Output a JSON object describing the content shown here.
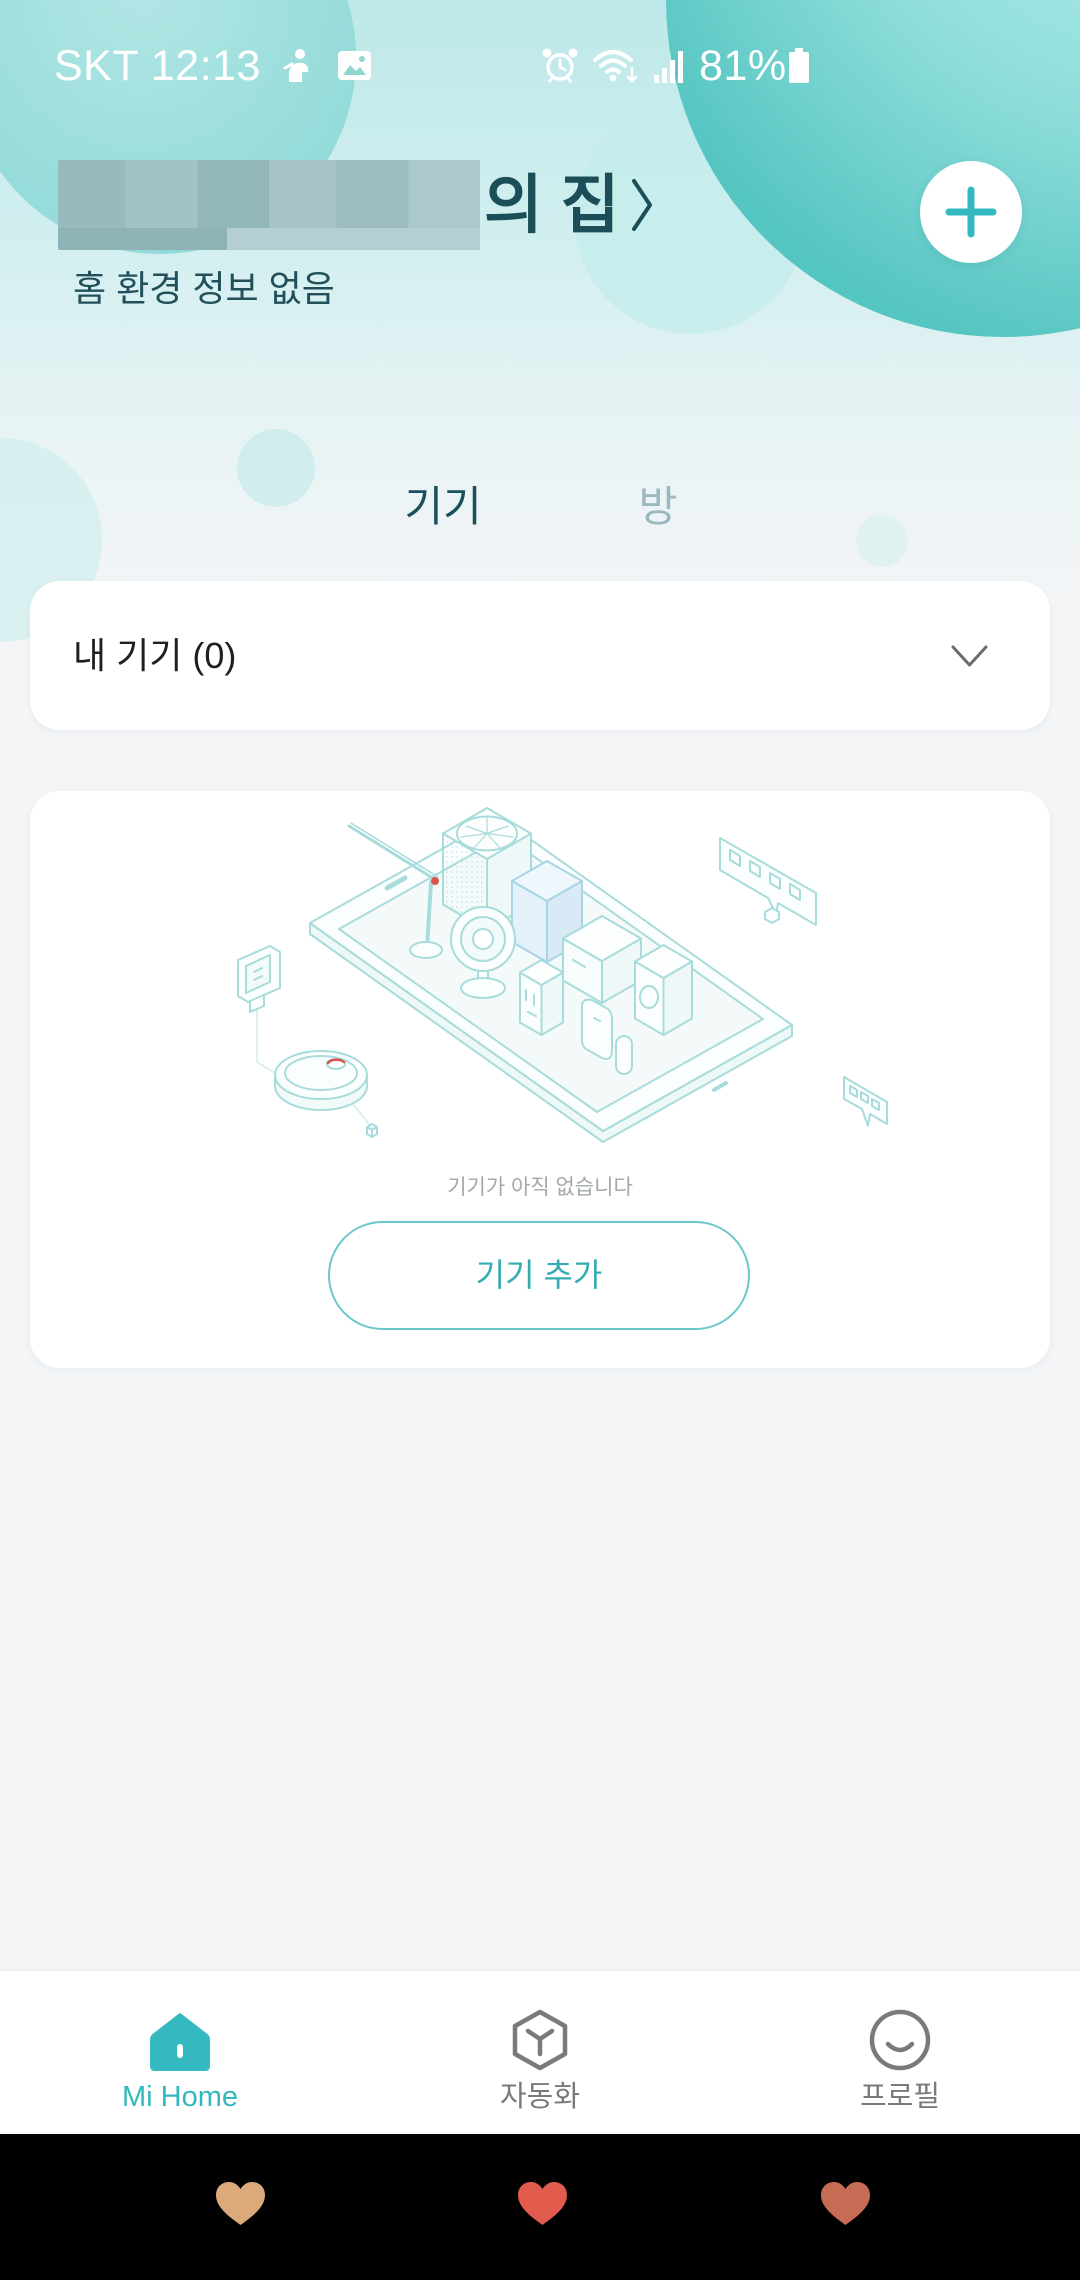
{
  "status_bar": {
    "carrier_time": "SKT 12:13",
    "battery_percent": "81%",
    "icons": [
      "notification-icon",
      "image-icon",
      "alarm-icon",
      "wifi-icon",
      "signal-icon",
      "battery-icon"
    ]
  },
  "header": {
    "home_name": "의 집",
    "subtitle": "홈 환경 정보 없음",
    "title_icon": "chevron-right-icon",
    "add_icon": "plus-icon"
  },
  "tabs": [
    {
      "label": "기기",
      "selected": true
    },
    {
      "label": "방",
      "selected": false
    }
  ],
  "my_devices": {
    "label": "내 기기 (0)",
    "expand_icon": "chevron-down-icon"
  },
  "empty_state": {
    "message": "기기가 아직 없습니다",
    "add_device_button": "기기 추가"
  },
  "bottom_nav": {
    "items": [
      {
        "label": "Mi Home",
        "icon": "home-icon",
        "active": true
      },
      {
        "label": "자동화",
        "icon": "automation-icon",
        "active": false
      },
      {
        "label": "프로필",
        "icon": "profile-icon",
        "active": false
      }
    ]
  },
  "system_nav": {
    "buttons": [
      {
        "icon": "heart-icon",
        "color": "#dcaa7a"
      },
      {
        "icon": "heart-icon",
        "color": "#e25c4d"
      },
      {
        "icon": "heart-icon",
        "color": "#c66c55"
      }
    ]
  },
  "colors": {
    "accent": "#33b8bf",
    "title": "#1b4e58",
    "tab_inactive": "#9ab8bd",
    "background": "#f3f5f7",
    "nav_inactive": "#7a7a7a"
  }
}
